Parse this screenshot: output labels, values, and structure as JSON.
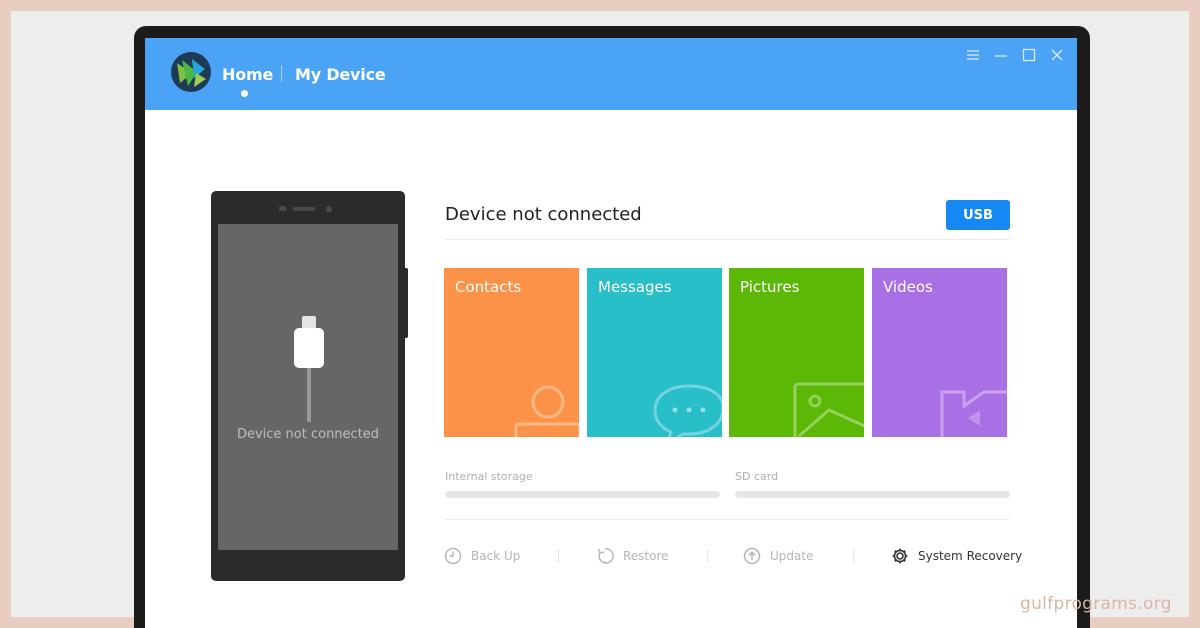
{
  "nav": {
    "home_label": "Home",
    "device_label": "My Device"
  },
  "window_controls": [
    "menu-icon",
    "minimize-icon",
    "maximize-icon",
    "close-icon"
  ],
  "phone": {
    "screen_text": "Device not connected"
  },
  "status": {
    "title": "Device not connected",
    "connection_button": "USB"
  },
  "tiles": [
    {
      "label": "Contacts",
      "color": "#fc9248",
      "icon": "contact-icon"
    },
    {
      "label": "Messages",
      "color": "#28bfc8",
      "icon": "chat-icon"
    },
    {
      "label": "Pictures",
      "color": "#5cb806",
      "icon": "picture-icon"
    },
    {
      "label": "Videos",
      "color": "#a970e6",
      "icon": "video-icon"
    }
  ],
  "storage": {
    "internal_label": "Internal storage",
    "internal_fill": 0,
    "sd_label": "SD card",
    "sd_fill": 0
  },
  "actions": [
    {
      "label": "Back Up",
      "icon": "backup-icon"
    },
    {
      "label": "Restore",
      "icon": "restore-icon"
    },
    {
      "label": "Update",
      "icon": "update-icon"
    },
    {
      "label": "System Recovery",
      "icon": "gear-icon"
    }
  ],
  "colors": {
    "header": "#4aa3f5",
    "primary_button": "#1688f4"
  },
  "watermark": "gulfprograms.org"
}
